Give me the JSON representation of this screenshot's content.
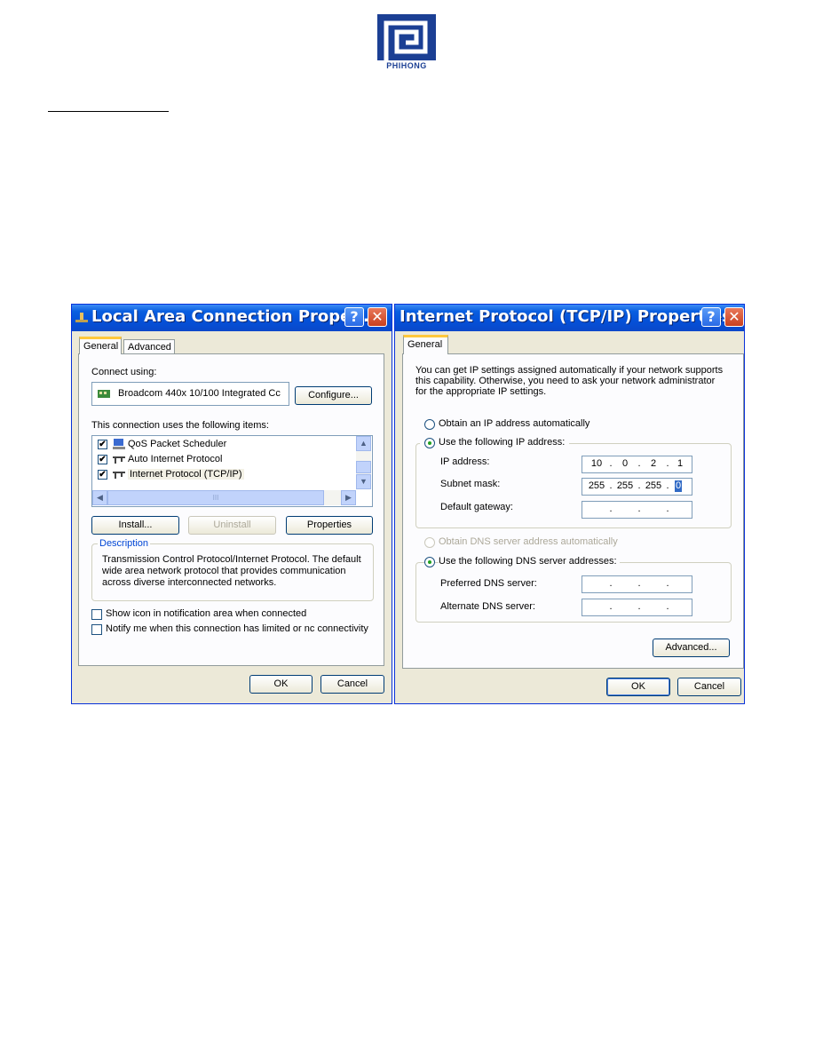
{
  "logo": {
    "text": "PHIHONG"
  },
  "left_window": {
    "title": "Local Area Connection Prope...",
    "help_glyph": "?",
    "close_glyph": "✕",
    "tabs": [
      "General",
      "Advanced"
    ],
    "connect_using_label": "Connect using:",
    "adapter_name": "Broadcom 440x 10/100 Integrated Cc",
    "configure_label": "Configure...",
    "items_label": "This connection uses the following items:",
    "items": [
      {
        "label": "QoS Packet Scheduler",
        "checked": true
      },
      {
        "label": "Auto Internet Protocol",
        "checked": true
      },
      {
        "label": "Internet Protocol (TCP/IP)",
        "checked": true
      }
    ],
    "check_glyph": "✔",
    "scroll_thumb_label": "III",
    "install_label": "Install...",
    "uninstall_label": "Uninstall",
    "properties_label": "Properties",
    "description_legend": "Description",
    "description_text": "Transmission Control Protocol/Internet Protocol. The default wide area network protocol that provides communication across diverse interconnected networks.",
    "show_icon_label": "Show icon in notification area when connected",
    "notify_label": "Notify me when this connection has limited or nc connectivity",
    "ok_label": "OK",
    "cancel_label": "Cancel"
  },
  "right_window": {
    "title": "Internet Protocol (TCP/IP) Properties",
    "help_glyph": "?",
    "close_glyph": "✕",
    "tabs": [
      "General"
    ],
    "intro_text": "You can get IP settings assigned automatically if your network supports this capability. Otherwise, you need to ask your network administrator for the appropriate IP settings.",
    "obtain_ip_label": "Obtain an IP address automatically",
    "use_ip_label": "Use the following IP address:",
    "ip_label": "IP address:",
    "ip_value": [
      "10",
      "0",
      "2",
      "1"
    ],
    "subnet_label": "Subnet mask:",
    "subnet_value": [
      "255",
      "255",
      "255",
      "0"
    ],
    "gateway_label": "Default gateway:",
    "obtain_dns_label": "Obtain DNS server address automatically",
    "use_dns_label": "Use the following DNS server addresses:",
    "preferred_dns_label": "Preferred DNS server:",
    "alternate_dns_label": "Alternate DNS server:",
    "dot": ".",
    "advanced_label": "Advanced...",
    "ok_label": "OK",
    "cancel_label": "Cancel"
  }
}
